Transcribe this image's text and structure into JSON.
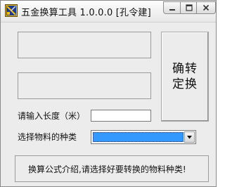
{
  "window": {
    "title": "五金换算工具 1.0.0.0 [孔令建]"
  },
  "title_buttons": {
    "minimize_icon": "minimize-icon",
    "maximize_icon": "maximize-icon",
    "close_icon": "close-icon"
  },
  "output": {
    "box1_value": "",
    "box2_value": ""
  },
  "convert_button": {
    "label": "确转定换"
  },
  "length": {
    "label": "请输入长度（米）",
    "value": ""
  },
  "material": {
    "label": "选择物料的种类",
    "selected": ""
  },
  "info": {
    "text": "换算公式介绍,请选择好要转换的物料种类!"
  },
  "colors": {
    "window_bg": "#ececec",
    "select_highlight": "#3399ff"
  }
}
